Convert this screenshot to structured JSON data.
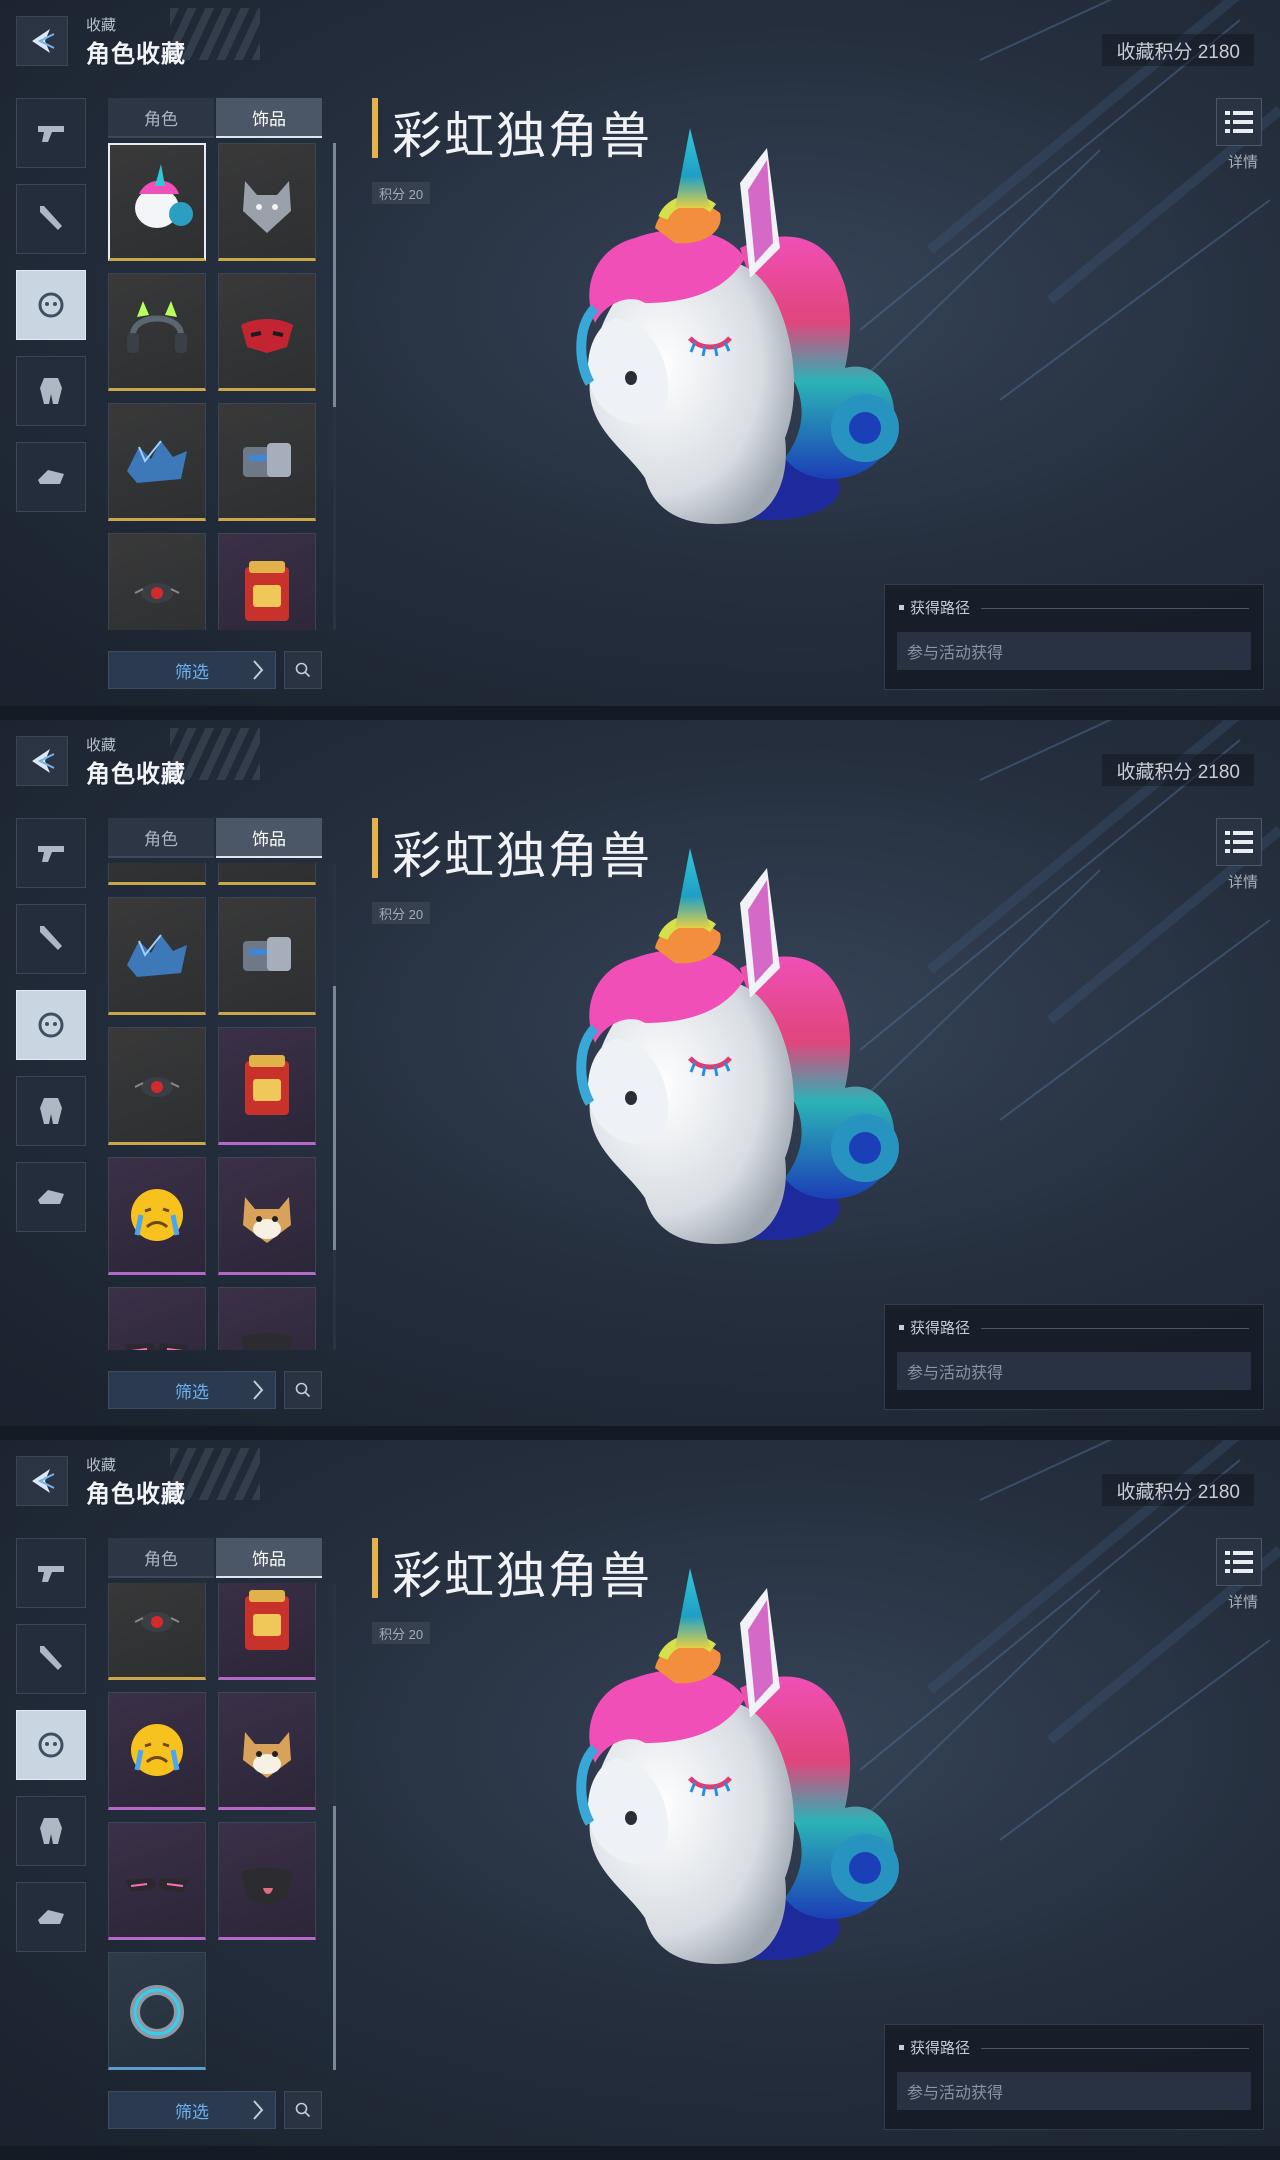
{
  "header": {
    "breadcrumb": "收藏",
    "title": "角色收藏",
    "points_label": "收藏积分 2180"
  },
  "rail": [
    {
      "name": "pistol-icon",
      "active": false
    },
    {
      "name": "melee-weapon-icon",
      "active": false
    },
    {
      "name": "character-face-icon",
      "active": true
    },
    {
      "name": "mech-icon",
      "active": false
    },
    {
      "name": "vehicle-icon",
      "active": false
    }
  ],
  "tabs": {
    "character": "角色",
    "accessory": "饰品"
  },
  "grid_items": [
    {
      "name": "rainbow-unicorn-head",
      "rarity": "gold",
      "icon": "unicorn-icon"
    },
    {
      "name": "grey-wolf-head",
      "rarity": "gold",
      "icon": "wolf-icon"
    },
    {
      "name": "cat-ear-headphones",
      "rarity": "gold",
      "icon": "headphones-icon"
    },
    {
      "name": "red-mask",
      "rarity": "gold",
      "icon": "mask-icon"
    },
    {
      "name": "blue-ice-armor",
      "rarity": "gold",
      "icon": "ice-armor-icon"
    },
    {
      "name": "steel-gauntlet",
      "rarity": "gold",
      "icon": "gauntlet-icon"
    },
    {
      "name": "red-eye-gadget",
      "rarity": "gold",
      "icon": "red-eye-icon"
    },
    {
      "name": "red-backpack",
      "rarity": "purple",
      "icon": "backpack-icon"
    },
    {
      "name": "crying-emoji",
      "rarity": "purple",
      "icon": "crying-emoji-icon"
    },
    {
      "name": "shiba-head",
      "rarity": "purple",
      "icon": "shiba-icon"
    },
    {
      "name": "dark-glasses",
      "rarity": "purple",
      "icon": "glasses-icon"
    },
    {
      "name": "black-mouth-mask",
      "rarity": "purple",
      "icon": "mouth-mask-icon"
    },
    {
      "name": "neon-ring",
      "rarity": "blue",
      "icon": "ring-icon"
    }
  ],
  "filter_label": "筛选",
  "item": {
    "name": "彩虹独角兽",
    "score": "积分 20",
    "detail_label": "详情"
  },
  "source": {
    "heading": "获得路径",
    "value": "参与活动获得"
  },
  "scroll_positions": [
    0,
    0.55,
    1
  ],
  "colors": {
    "gold": "#c9a74a",
    "purple": "#b469c9",
    "blue": "#5aa0cf",
    "title_accent": "#e5b34e",
    "filter_text": "#6ab3f3"
  }
}
